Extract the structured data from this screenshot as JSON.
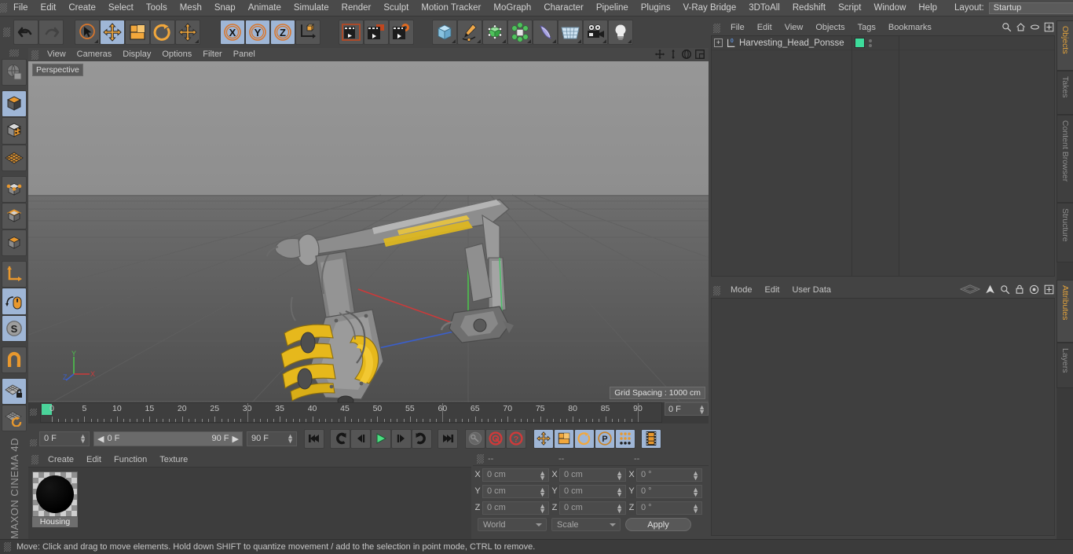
{
  "app": {
    "brand_top": "MAXON",
    "brand_bottom": "CINEMA 4D"
  },
  "menubar": {
    "items": [
      "File",
      "Edit",
      "Create",
      "Select",
      "Tools",
      "Mesh",
      "Snap",
      "Animate",
      "Simulate",
      "Render",
      "Sculpt",
      "Motion Tracker",
      "MoGraph",
      "Character",
      "Pipeline",
      "Plugins",
      "V-Ray Bridge",
      "3DToAll",
      "Redshift",
      "Script",
      "Window",
      "Help"
    ],
    "layout_label": "Layout:",
    "layout_value": "Startup",
    "search_icon": "magnifier-icon"
  },
  "toolbar": {
    "groups": [
      {
        "name": "history",
        "buttons": [
          {
            "name": "undo-button",
            "icon": "undo-arrow-icon",
            "selected": false
          },
          {
            "name": "redo-button",
            "icon": "redo-arrow-icon",
            "selected": false
          }
        ]
      },
      {
        "name": "transform-tools",
        "buttons": [
          {
            "name": "live-selection-tool",
            "icon": "cursor-circle-icon",
            "selected": false
          },
          {
            "name": "move-tool",
            "icon": "move-cross-icon",
            "selected": true
          },
          {
            "name": "scale-tool",
            "icon": "scale-box-icon",
            "selected": false
          },
          {
            "name": "rotate-tool",
            "icon": "rotate-arc-icon",
            "selected": false
          },
          {
            "name": "dynamic-place-tool",
            "icon": "move-cross-icon",
            "selected": false
          }
        ]
      },
      {
        "name": "axis-locks",
        "buttons": [
          {
            "name": "lock-x-axis-button",
            "icon": "x-axis-icon",
            "label": "X",
            "selected": true
          },
          {
            "name": "lock-y-axis-button",
            "icon": "y-axis-icon",
            "label": "Y",
            "selected": true
          },
          {
            "name": "lock-z-axis-button",
            "icon": "z-axis-icon",
            "label": "Z",
            "selected": true
          },
          {
            "name": "coordinate-system-button",
            "icon": "world-object-axis-icon",
            "selected": false
          }
        ]
      },
      {
        "name": "render-group",
        "buttons": [
          {
            "name": "render-view-button",
            "icon": "render-view-icon",
            "selected": false
          },
          {
            "name": "render-to-picture-viewer-button",
            "icon": "render-picture-viewer-icon",
            "selected": false
          },
          {
            "name": "render-settings-button",
            "icon": "render-settings-gear-icon",
            "selected": false
          }
        ]
      },
      {
        "name": "create-group",
        "buttons": [
          {
            "name": "add-cube-button",
            "icon": "cube-primitive-icon",
            "selected": false
          },
          {
            "name": "add-spline-button",
            "icon": "pen-spline-icon",
            "selected": false
          },
          {
            "name": "add-nurbs-button",
            "icon": "generator-cube-icon",
            "selected": false
          },
          {
            "name": "add-array-button",
            "icon": "cloner-array-icon",
            "selected": false
          },
          {
            "name": "add-deformer-button",
            "icon": "bend-deformer-icon",
            "selected": false
          },
          {
            "name": "add-scene-object-button",
            "icon": "floor-grid-icon",
            "selected": false
          },
          {
            "name": "add-camera-button",
            "icon": "camera-icon",
            "selected": false
          },
          {
            "name": "add-light-button",
            "icon": "lightbulb-icon",
            "selected": false
          }
        ]
      }
    ]
  },
  "left_toolbar": {
    "buttons": [
      {
        "name": "make-editable-button",
        "icon": "globe-editable-icon",
        "selected": false
      },
      {
        "name": "model-mode-button",
        "icon": "model-cube-icon",
        "selected": true
      },
      {
        "name": "texture-mode-button",
        "icon": "texture-checker-cube-icon",
        "selected": false
      },
      {
        "name": "workplane-mode-button",
        "icon": "workplane-grid-icon",
        "selected": false
      },
      {
        "name": "points-mode-button",
        "icon": "points-cube-icon",
        "selected": false
      },
      {
        "name": "edges-mode-button",
        "icon": "edges-cube-icon",
        "selected": false
      },
      {
        "name": "polygons-mode-button",
        "icon": "polygons-cube-icon",
        "selected": false
      },
      {
        "name": "object-axis-mode-button",
        "icon": "axis-l-icon",
        "selected": false
      },
      {
        "name": "enable-axis-modification-button",
        "icon": "mouse-axis-icon",
        "selected": true
      },
      {
        "name": "soft-selection-button",
        "icon": "s-sphere-icon",
        "selected": true
      },
      {
        "name": "enable-snap-button",
        "icon": "magnet-icon",
        "selected": false
      },
      {
        "name": "workplane-lock-button",
        "icon": "workplane-lock-icon",
        "selected": true
      },
      {
        "name": "planar-workplane-button",
        "icon": "workplane-rotate-icon",
        "selected": false
      }
    ]
  },
  "viewport": {
    "menu": [
      "View",
      "Cameras",
      "Display",
      "Options",
      "Filter",
      "Panel"
    ],
    "corner_icons": [
      "pan-view-icon",
      "dolly-view-icon",
      "rotate-view-icon",
      "maximize-view-icon"
    ],
    "label": "Perspective",
    "grid_spacing": "Grid Spacing : 1000 cm",
    "axis_gizmo": {
      "y_label": "Y",
      "x_label": "X",
      "z_label": "Z"
    }
  },
  "timeline": {
    "ticks": [
      0,
      5,
      10,
      15,
      20,
      25,
      30,
      35,
      40,
      45,
      50,
      55,
      60,
      65,
      70,
      75,
      80,
      85,
      90
    ],
    "current_frame_field": "0 F",
    "playhead_frame": 0
  },
  "transport": {
    "current_frame": "0 F",
    "range_start": "0 F",
    "range_end": "90 F",
    "end_frame": "90 F",
    "buttons": [
      {
        "name": "go-to-start-button",
        "icon": "skip-start-icon",
        "selected": false
      },
      {
        "name": "go-to-previous-keyframe-button",
        "icon": "prev-key-icon",
        "selected": false
      },
      {
        "name": "go-to-previous-frame-button",
        "icon": "step-back-icon",
        "selected": false
      },
      {
        "name": "play-button",
        "icon": "play-icon",
        "selected": false
      },
      {
        "name": "go-to-next-frame-button",
        "icon": "step-forward-icon",
        "selected": false
      },
      {
        "name": "go-to-next-keyframe-button",
        "icon": "next-key-icon",
        "selected": false
      },
      {
        "name": "go-to-end-button",
        "icon": "skip-end-icon",
        "selected": false
      },
      {
        "name": "record-active-objects-button",
        "icon": "key-icon",
        "selected": false
      },
      {
        "name": "autokeying-button",
        "icon": "autokey-circle-icon",
        "selected": false
      },
      {
        "name": "keyframe-selection-button",
        "icon": "question-circle-icon",
        "selected": false
      },
      {
        "name": "record-position-button",
        "icon": "position-cross-icon",
        "selected": true
      },
      {
        "name": "record-scale-button",
        "icon": "scale-box-icon",
        "selected": true
      },
      {
        "name": "record-rotation-button",
        "icon": "rotation-arc-icon",
        "selected": true
      },
      {
        "name": "record-parameter-button",
        "icon": "p-circle-icon",
        "selected": true
      },
      {
        "name": "record-point-level-animation-button",
        "icon": "pla-dots-icon",
        "selected": true
      },
      {
        "name": "animation-layers-button",
        "icon": "film-strip-icon",
        "selected": true
      }
    ]
  },
  "material_manager": {
    "menu": [
      "Create",
      "Edit",
      "Function",
      "Texture"
    ],
    "materials": [
      {
        "name": "Housing",
        "swatch_color": "#000000"
      }
    ]
  },
  "coordinates": {
    "headers": [
      "--",
      "--",
      "--"
    ],
    "rows": [
      {
        "label": "X",
        "position": "0 cm",
        "size": "0 cm",
        "rotation": "0 °"
      },
      {
        "label": "Y",
        "position": "0 cm",
        "size": "0 cm",
        "rotation": "0 °"
      },
      {
        "label": "Z",
        "position": "0 cm",
        "size": "0 cm",
        "rotation": "0 °"
      }
    ],
    "system": "World",
    "mode": "Scale",
    "apply_label": "Apply"
  },
  "object_manager": {
    "menu": [
      "File",
      "Edit",
      "View",
      "Objects",
      "Tags",
      "Bookmarks"
    ],
    "icons": [
      "magnifier-icon",
      "home-icon",
      "ellipse-icon",
      "plus-box-icon"
    ],
    "objects": [
      {
        "name": "Harvesting_Head_Ponsse",
        "layer_index": "0",
        "tag_color": "#3ddc9b"
      }
    ]
  },
  "attribute_manager": {
    "menu": [
      "Mode",
      "Edit",
      "User Data"
    ],
    "icons": [
      "history-icon",
      "arrow-up-icon",
      "magnifier-icon",
      "lock-icon",
      "target-icon",
      "plus-box-icon"
    ]
  },
  "vertical_tabs": {
    "top": [
      {
        "label": "Objects",
        "active": true
      },
      {
        "label": "Takes",
        "active": false
      },
      {
        "label": "Content Browser",
        "active": false
      },
      {
        "label": "Structure",
        "active": false
      }
    ],
    "bottom": [
      {
        "label": "Attributes",
        "active": true
      },
      {
        "label": "Layers",
        "active": false
      }
    ]
  },
  "status_bar": {
    "message": "Move: Click and drag to move elements. Hold down SHIFT to quantize movement / add to the selection in point mode, CTRL to remove."
  }
}
